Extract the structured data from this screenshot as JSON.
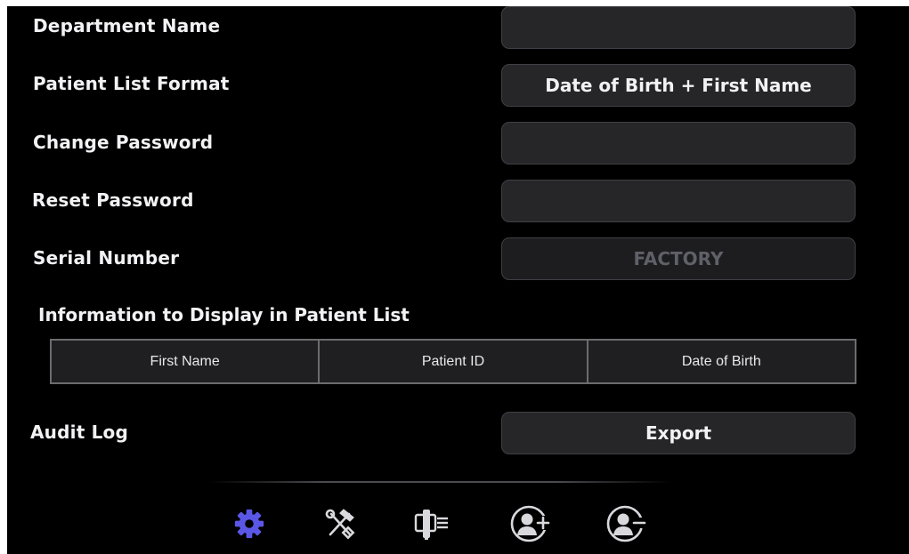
{
  "settings": {
    "rows": [
      {
        "label": "Department Name",
        "value": ""
      },
      {
        "label": "Patient List Format",
        "value": "Date of Birth + First Name"
      },
      {
        "label": "Change Password",
        "value": ""
      },
      {
        "label": "Reset Password",
        "value": ""
      },
      {
        "label": "Serial Number",
        "value": "FACTORY"
      }
    ],
    "patient_list_section": {
      "title": "Information to Display in Patient List",
      "columns": [
        "First Name",
        "Patient ID",
        "Date of Birth"
      ]
    },
    "audit_log": {
      "label": "Audit Log",
      "button_label": "Export"
    }
  },
  "bottom_nav": {
    "items": [
      {
        "icon": "gear-icon",
        "active": true
      },
      {
        "icon": "tools-icon",
        "active": false
      },
      {
        "icon": "probe-list-icon",
        "active": false
      },
      {
        "icon": "add-user-icon",
        "active": false
      },
      {
        "icon": "remove-user-icon",
        "active": false
      }
    ],
    "active_color": "#5b57e6",
    "inactive_color": "#d9d9dd"
  }
}
